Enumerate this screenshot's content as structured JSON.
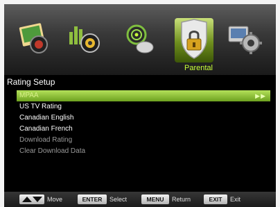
{
  "section_label": "Parental",
  "heading": "Rating Setup",
  "menu": {
    "items": [
      {
        "label": "MPAA",
        "state": "selected"
      },
      {
        "label": "US TV Rating",
        "state": "normal"
      },
      {
        "label": "Canadian English",
        "state": "normal"
      },
      {
        "label": "Canadian French",
        "state": "normal"
      },
      {
        "label": "Download Rating",
        "state": "disabled"
      },
      {
        "label": "Clear Download Data",
        "state": "disabled"
      }
    ]
  },
  "top_icons": [
    "picture-icon",
    "sound-icon",
    "channel-icon",
    "parental-lock-icon",
    "setup-gear-icon"
  ],
  "footer": {
    "move": {
      "key": "up-down-arrows",
      "label": "Move"
    },
    "select": {
      "key": "ENTER",
      "label": "Select"
    },
    "return": {
      "key": "MENU",
      "label": "Return"
    },
    "exit": {
      "key": "EXIT",
      "label": "Exit"
    }
  },
  "colors": {
    "accent": "#8ec63f",
    "highlight_text": "#c8ff3a",
    "background": "#000000"
  }
}
